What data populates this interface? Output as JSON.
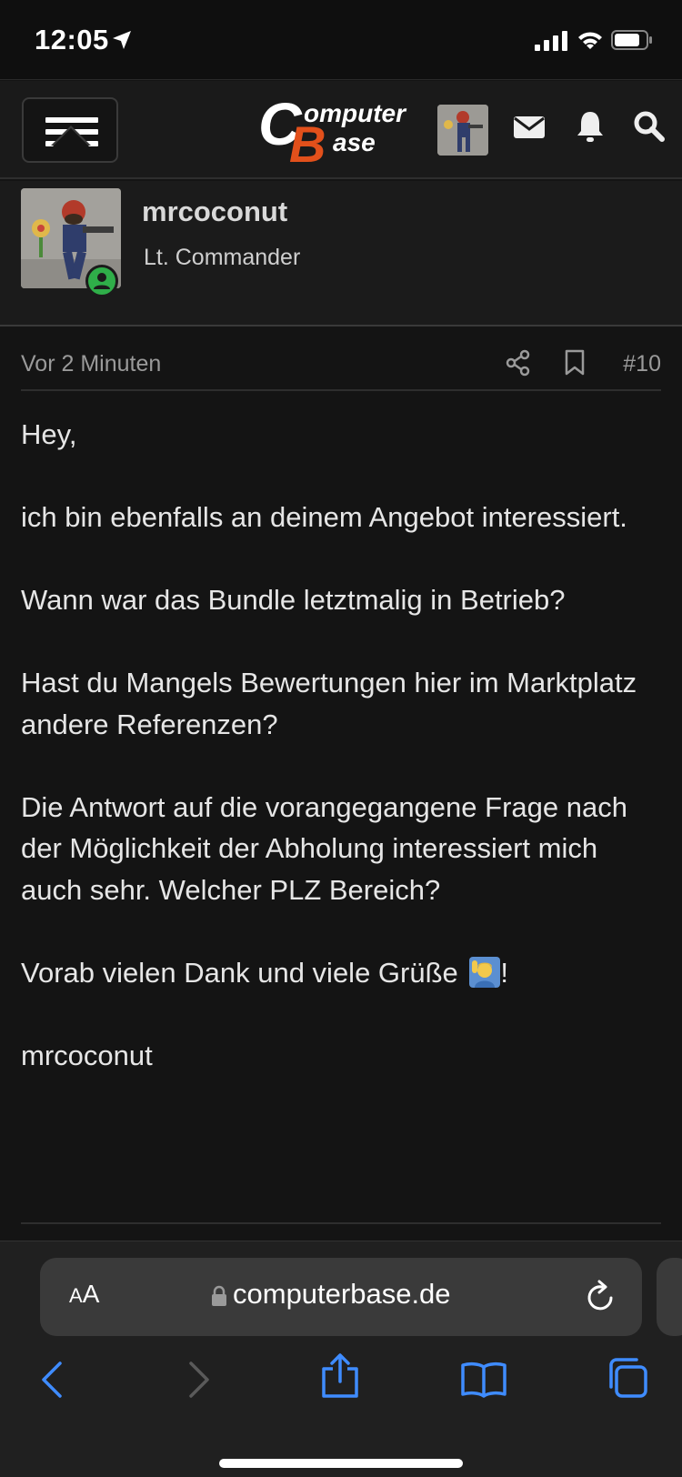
{
  "status_bar": {
    "time": "12:05"
  },
  "header": {
    "logo_top": "Computer",
    "logo_bottom": "Base",
    "logo_letter_c": "C",
    "logo_letter_b": "B",
    "icons": [
      "menu-icon",
      "avatar",
      "envelope-icon",
      "bell-icon",
      "search-icon"
    ]
  },
  "author": {
    "name": "mrcoconut",
    "title": "Lt. Commander",
    "online": true
  },
  "post": {
    "time": "Vor 2 Minuten",
    "number": "#10",
    "paragraphs": [
      "Hey,",
      "ich bin ebenfalls an deinem Angebot interessiert.",
      "Wann war das Bundle letztmalig in Betrieb?",
      "Hast du Mangels Bewertungen hier im Marktplatz andere Referenzen?",
      "Die Antwort auf die vorangegangene Frage nach der Möglichkeit der Abholung interessiert mich auch sehr. Welcher PLZ Bereich?",
      "Vorab vielen Dank und viele Grüße",
      "!",
      "mrcoconut"
    ]
  },
  "browser": {
    "aa_label_small": "A",
    "aa_label_large": "A",
    "url": "computerbase.de"
  },
  "colors": {
    "accent_logo": "#e2501b",
    "online": "#2fae49",
    "toolbar_blue": "#3f8cff"
  }
}
